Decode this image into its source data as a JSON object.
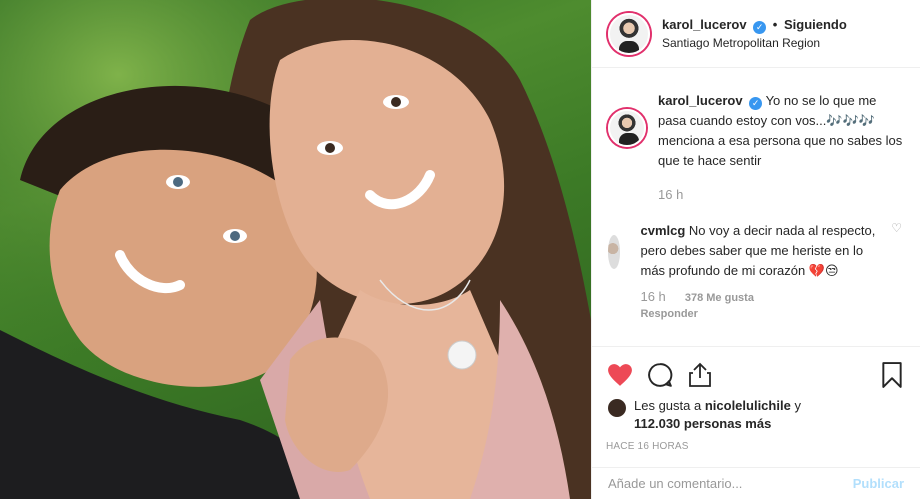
{
  "post": {
    "username": "karol_lucerov",
    "follow_state": "Siguiendo",
    "location": "Santiago Metropolitan Region"
  },
  "caption": {
    "username": "karol_lucerov",
    "text": "Yo no se lo que me pasa cuando estoy con vos...🎶🎶🎶 menciona a esa persona que no sabes los que te hace sentir",
    "time": "16 h"
  },
  "comment": {
    "username": "cvmlcg",
    "text": "No voy a decir nada al respecto, pero debes saber que me heriste en lo más profundo de mi corazón 💔😒",
    "time": "16 h",
    "likes": "378 Me gusta",
    "reply": "Responder"
  },
  "likes": {
    "prefix": "Les gusta a",
    "user": "nicolelulichile",
    "connector": "y",
    "count": "112.030 personas más"
  },
  "date": "HACE 16 HORAS",
  "add_comment": {
    "placeholder": "Añade un comentario...",
    "publish": "Publicar"
  },
  "colors": {
    "like_red": "#ed4956",
    "verified_blue": "#3897f0",
    "publish_disabled": "#b2dffc"
  },
  "icons": [
    "heart-icon",
    "comment-icon",
    "share-icon",
    "bookmark-icon",
    "verified-icon"
  ]
}
